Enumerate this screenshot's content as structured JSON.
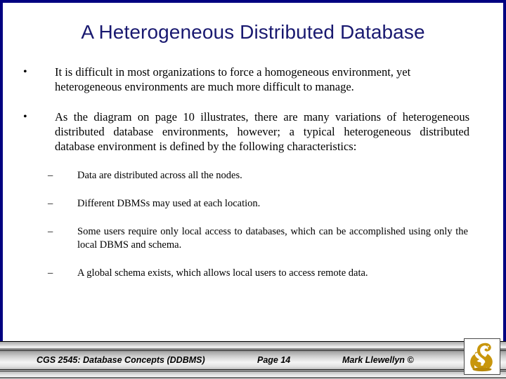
{
  "slide": {
    "title": "A Heterogeneous Distributed Database",
    "accent_color": "#191970",
    "frame_color": "#000080",
    "body_text_color": "#000000"
  },
  "content": {
    "bullets": [
      {
        "marker": "•",
        "text": "It is difficult in most organizations to force a homogeneous environment, yet heterogeneous environments are much more difficult to manage."
      },
      {
        "marker": "•",
        "text": "As the diagram on page 10 illustrates, there are many variations of heterogeneous distributed database environments, however; a typical heterogeneous distributed database environment is defined by the following characteristics:"
      }
    ],
    "sub_bullets": [
      {
        "marker": "–",
        "text": "Data are distributed across all the nodes."
      },
      {
        "marker": "–",
        "text": "Different DBMSs may used at each location."
      },
      {
        "marker": "–",
        "text": "Some users require only local access to databases, which can be accomplished using only the local DBMS and schema."
      },
      {
        "marker": "–",
        "text": "A global schema exists, which allows local users to access remote data."
      }
    ]
  },
  "footer": {
    "course": "CGS 2545: Database Concepts  (DDBMS)",
    "page": "Page 14",
    "author": "Mark Llewellyn ©",
    "logo_name": "pegasus-logo",
    "logo_color": "#c8960c"
  }
}
